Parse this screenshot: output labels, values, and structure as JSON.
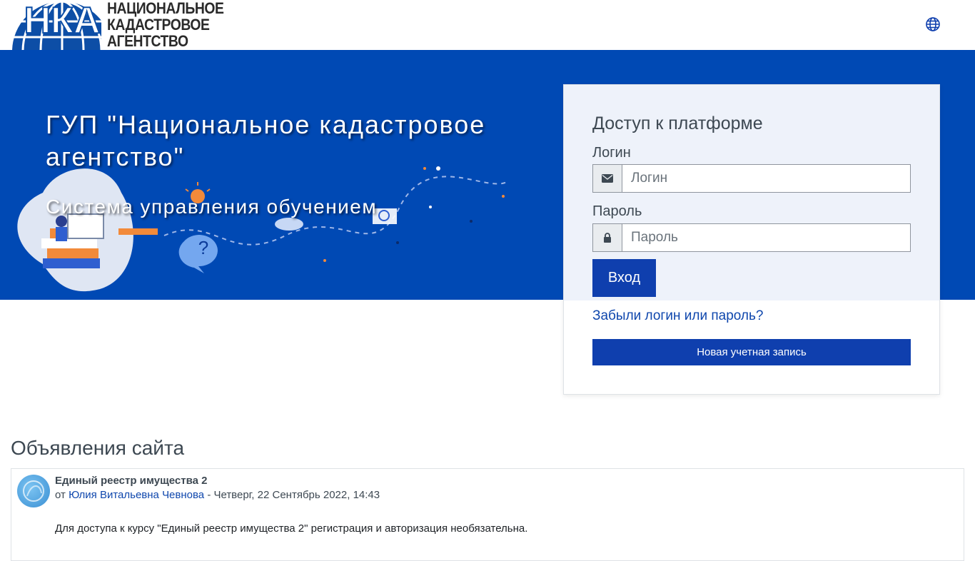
{
  "header": {
    "logo_abbr": "НКА",
    "logo_lines": [
      "НАЦИОНАЛЬНОЕ",
      "КАДАСТРОВОЕ",
      "АГЕНТСТВО"
    ],
    "language_icon": "globe-icon"
  },
  "hero": {
    "title": "ГУП \"Национальное кадастровое агентство\"",
    "subtitle": "Система управления обучением"
  },
  "login": {
    "heading": "Доступ к платформе",
    "username_label": "Логин",
    "username_placeholder": "Логин",
    "username_icon": "envelope-icon",
    "password_label": "Пароль",
    "password_placeholder": "Пароль",
    "password_icon": "lock-icon",
    "submit_label": "Вход",
    "forgot_link": "Забыли логин или пароль?",
    "new_account_label": "Новая учетная запись"
  },
  "announcements": {
    "title": "Объявления сайта",
    "posts": [
      {
        "subject": "Единый реестр имущества 2",
        "by": "от",
        "author": "Юлия Витальевна Чевнова",
        "date": "- Четверг, 22 Сентябрь 2022, 14:43",
        "body": "Для доступа к курсу \"Единый реестр имущества 2\" регистрация и авторизация необязательна."
      }
    ]
  },
  "colors": {
    "hero_bg": "#0049b4",
    "primary_button": "#0f3fae",
    "link": "#0f47ad",
    "card_tint": "#eef2fa"
  }
}
